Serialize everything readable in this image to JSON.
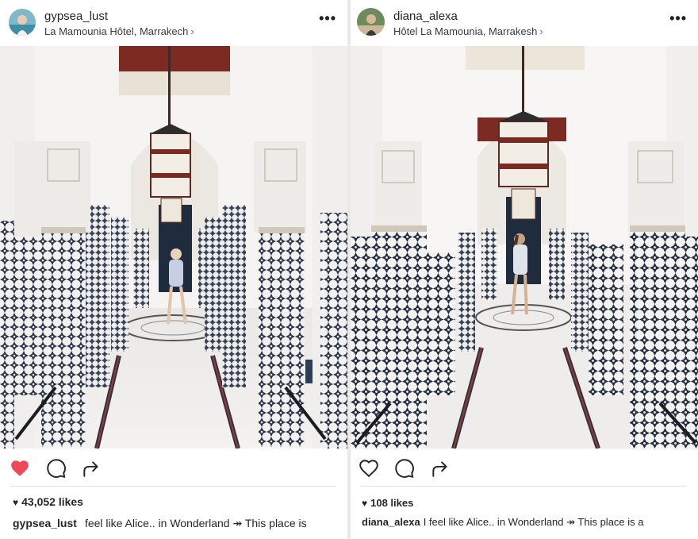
{
  "posts": [
    {
      "username": "gypsea_lust",
      "location": "La Mamounia Hôtel, Marrakech",
      "location_chevron": "›",
      "more_label": "•••",
      "liked": true,
      "likes_text": "43,052 likes",
      "caption_user": "gypsea_lust",
      "caption_text": "feel like Alice.. in Wonderland ↠ This place is"
    },
    {
      "username": "diana_alexa",
      "location": "Hôtel La Mamounia, Marrakesh",
      "location_chevron": "›",
      "more_label": "•••",
      "liked": false,
      "likes_text": "108 likes",
      "caption_user": "diana_alexa",
      "caption_text": "I feel like Alice.. in Wonderland ↠ This place is a"
    }
  ],
  "colors": {
    "heart_liked": "#ed4956",
    "icon_stroke": "#262626",
    "tile_blue": "#2c3e57",
    "wall_white": "#f4f3f1",
    "ceiling_red": "#8a2a22"
  },
  "icons": [
    "heart-icon",
    "comment-icon",
    "share-icon",
    "more-icon",
    "chevron-right-icon"
  ]
}
